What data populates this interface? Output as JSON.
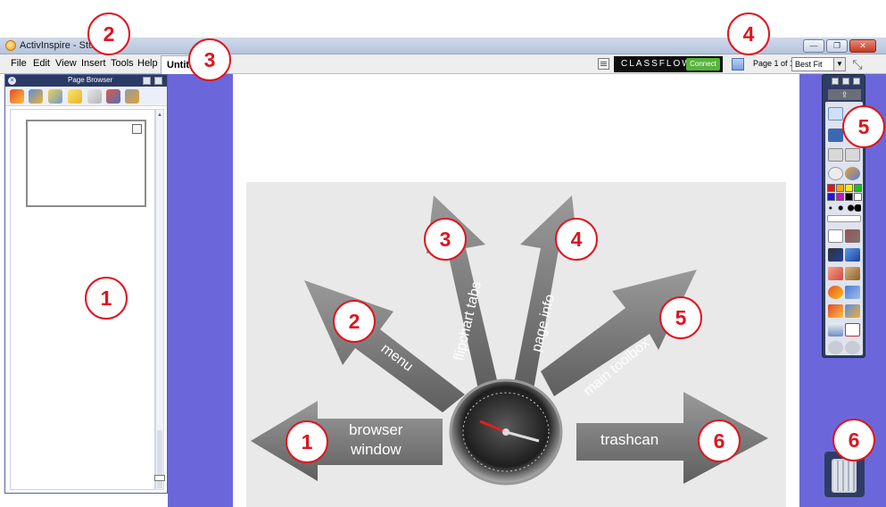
{
  "window": {
    "title": "ActivInspire - Studio",
    "min_symbol": "—",
    "max_symbol": "❐",
    "close_symbol": "✕"
  },
  "menubar": {
    "items": [
      "File",
      "Edit",
      "View",
      "Insert",
      "Tools",
      "Help"
    ],
    "doc_tab": "Untit",
    "classflow": {
      "brand": "CLASSFLOW",
      "connect": "Connect"
    },
    "page_info": "Page 1 of 1",
    "zoom": {
      "value": "Best Fit",
      "arrow": "▼"
    },
    "fullscreen_symbol": "⤡"
  },
  "page_browser": {
    "title": "Page Browser",
    "close_symbol": "×",
    "tool_icons": [
      "flipchart-icon",
      "image-icon",
      "home-icon",
      "notes-icon",
      "properties-icon",
      "object-browser-icon",
      "actions-icon"
    ],
    "scroll_up": "▲"
  },
  "graphic": {
    "labels": {
      "browser_line1": "browser",
      "browser_line2": "window",
      "menu": "menu",
      "flipchart": "flipchart tabs",
      "page_info": "page info",
      "toolbox": "main toolbox",
      "trashcan": "trashcan"
    },
    "numbers": [
      "1",
      "2",
      "3",
      "4",
      "5",
      "6"
    ]
  },
  "toolbox": {
    "export_symbol": "⇪",
    "colors": [
      "#e01818",
      "#f8a800",
      "#f0f000",
      "#18c018",
      "#1818e0",
      "#c018c0",
      "#000000",
      "#ffffff"
    ]
  },
  "callouts": [
    "1",
    "2",
    "3",
    "4",
    "5",
    "6"
  ],
  "colors": {
    "accent": "#e0141e",
    "panel_blue": "#6b67da",
    "toolbox_navy": "#2e3d66"
  }
}
